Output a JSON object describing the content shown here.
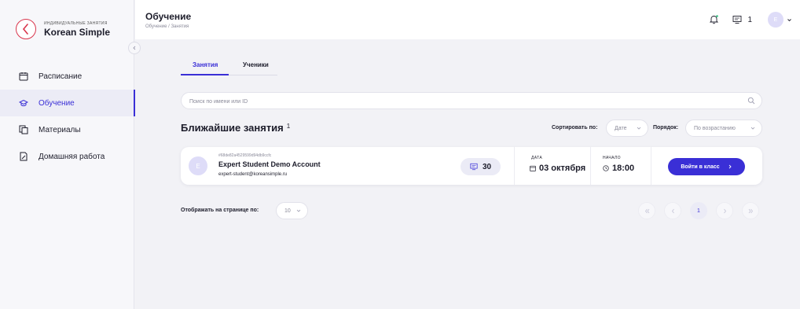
{
  "brand": {
    "subtitle": "индивидуальные занятия",
    "name": "Korean Simple"
  },
  "nav": [
    {
      "label": "Расписание",
      "icon": "calendar-icon",
      "active": false
    },
    {
      "label": "Обучение",
      "icon": "graduation-cap-icon",
      "active": true
    },
    {
      "label": "Материалы",
      "icon": "materials-icon",
      "active": false
    },
    {
      "label": "Домашняя работа",
      "icon": "homework-icon",
      "active": false
    }
  ],
  "header": {
    "title": "Обучение",
    "breadcrumb": "Обучение / Занятия",
    "class_count": "1",
    "avatar_letter": "E"
  },
  "tabs": [
    {
      "label": "Занятия",
      "active": true
    },
    {
      "label": "Ученики",
      "active": false
    }
  ],
  "search": {
    "placeholder": "Поиск по имени или ID"
  },
  "section": {
    "title": "Ближайшие занятия",
    "count": "1",
    "sort_label": "Сортировать по:",
    "sort_value": "Дате",
    "order_label": "Порядок:",
    "order_value": "По возрастанию"
  },
  "lessons": [
    {
      "avatar_letter": "E",
      "id": "#68de82a4529599d94db9ccfc",
      "name": "Expert Student Demo Account",
      "email": "expert-student@koreansimple.ru",
      "room": "30",
      "date_label": "ДАТА",
      "date_value": "03 октября",
      "time_label": "НАЧАЛО",
      "time_value": "18:00",
      "enter_label": "Войти в класс"
    }
  ],
  "pagination": {
    "per_page_label": "Отображать на странице по:",
    "per_page_value": "10",
    "current_page": "1"
  },
  "colors": {
    "accent": "#3a2fd6",
    "brand_red": "#d9364d",
    "background": "#f2f2f6"
  }
}
